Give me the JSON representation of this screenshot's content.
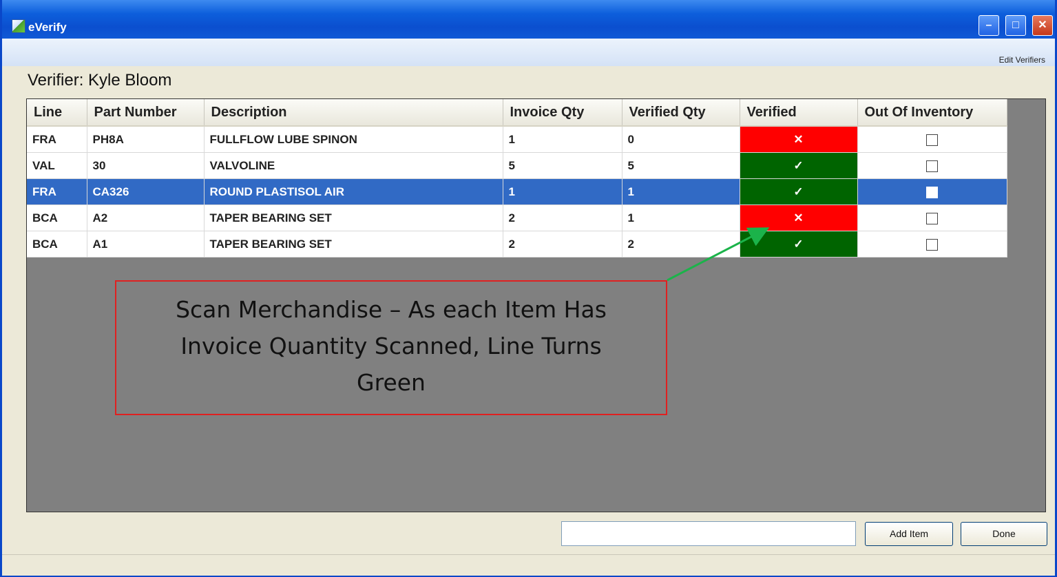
{
  "window": {
    "title": "eVerify",
    "controls": {
      "minimize": "–",
      "maximize": "□",
      "close": "✕"
    }
  },
  "menu": {
    "edit_verifiers": "Edit Verifiers"
  },
  "verifier": {
    "label": "Verifier: Kyle Bloom"
  },
  "grid": {
    "columns": [
      "Line",
      "Part Number",
      "Description",
      "Invoice Qty",
      "Verified Qty",
      "Verified",
      "Out Of Inventory"
    ],
    "rows": [
      {
        "line": "FRA",
        "part": "PH8A",
        "description": "FULLFLOW LUBE SPINON",
        "invoice_qty": "1",
        "verified_qty": "0",
        "verified": "✕",
        "verified_status": "no",
        "out_of_inventory": false,
        "selected": false
      },
      {
        "line": "VAL",
        "part": "30",
        "description": "VALVOLINE",
        "invoice_qty": "5",
        "verified_qty": "5",
        "verified": "✓",
        "verified_status": "yes",
        "out_of_inventory": false,
        "selected": false
      },
      {
        "line": "FRA",
        "part": "CA326",
        "description": "ROUND PLASTISOL AIR",
        "invoice_qty": "1",
        "verified_qty": "1",
        "verified": "✓",
        "verified_status": "yes",
        "out_of_inventory": false,
        "selected": true
      },
      {
        "line": "BCA",
        "part": "A2",
        "description": "TAPER BEARING SET",
        "invoice_qty": "2",
        "verified_qty": "1",
        "verified": "✕",
        "verified_status": "no",
        "out_of_inventory": false,
        "selected": false
      },
      {
        "line": "BCA",
        "part": "A1",
        "description": "TAPER BEARING SET",
        "invoice_qty": "2",
        "verified_qty": "2",
        "verified": "✓",
        "verified_status": "yes",
        "out_of_inventory": false,
        "selected": false
      }
    ]
  },
  "callout": {
    "line1": "Scan Merchandise – As each Item Has",
    "line2": "Invoice Quantity Scanned, Line Turns",
    "line3": "Green"
  },
  "footer": {
    "scan_input_value": "",
    "add_item_label": "Add Item",
    "done_label": "Done"
  },
  "colors": {
    "verified_yes": "#006400",
    "verified_no": "#ff0000",
    "selected_row": "#316ac5",
    "grid_background": "#808080",
    "callout_border": "#e02020",
    "arrow": "#1bb34a"
  }
}
